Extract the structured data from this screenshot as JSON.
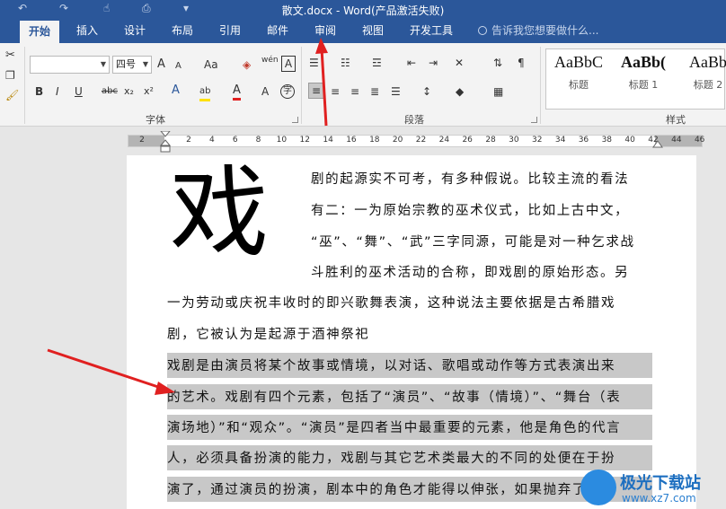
{
  "window": {
    "title": "散文.docx - Word(产品激活失败)",
    "quick_access": [
      "undo-icon",
      "redo-icon",
      "touch-mode-icon",
      "print-preview-icon",
      "customize-icon"
    ]
  },
  "tabs": [
    {
      "label": "开始",
      "active": true
    },
    {
      "label": "插入"
    },
    {
      "label": "设计"
    },
    {
      "label": "布局"
    },
    {
      "label": "引用"
    },
    {
      "label": "邮件"
    },
    {
      "label": "审阅"
    },
    {
      "label": "视图"
    },
    {
      "label": "开发工具"
    }
  ],
  "tell_me": {
    "placeholder": "告诉我您想要做什么..."
  },
  "ribbon": {
    "font": {
      "font_name": "",
      "font_size": "四号",
      "group_label": "字体",
      "grow_label": "A",
      "shrink_label": "A",
      "case_label": "Aa",
      "phonetic_label": "wén",
      "border_label": "A",
      "bold_label": "B",
      "italic_label": "I",
      "underline_label": "U",
      "strike_label": "abc",
      "sub_label": "x₂",
      "sup_label": "x²",
      "highlight_label": "ab",
      "color_label": "A",
      "enclose_label": "字"
    },
    "paragraph": {
      "group_label": "段落"
    },
    "styles": {
      "group_label": "样式",
      "items": [
        {
          "sample": "AaBbC",
          "name": "标题"
        },
        {
          "sample": "AaBb(",
          "name": "标题 1"
        },
        {
          "sample": "AaBb",
          "name": "标题 2"
        }
      ]
    }
  },
  "ruler": {
    "ticks": [
      "2",
      "2",
      "4",
      "6",
      "8",
      "10",
      "12",
      "14",
      "16",
      "18",
      "20",
      "22",
      "24",
      "26",
      "28",
      "30",
      "32",
      "34",
      "36",
      "38",
      "40",
      "42",
      "44",
      "46"
    ]
  },
  "document": {
    "drop_cap": "戏",
    "lines": [
      "剧的起源实不可考，有多种假说。比较主流的看法",
      "有二：一为原始宗教的巫术仪式，比如上古中文，",
      "“巫”、“舞”、“武”三字同源，可能是对一种乞求战",
      "斗胜利的巫术活动的合称，即戏剧的原始形态。另",
      "一为劳动或庆祝丰收时的即兴歌舞表演，这种说法主要依据是古希腊戏",
      "剧，它被认为是起源于酒神祭祀",
      "戏剧是由演员将某个故事或情境，以对话、歌唱或动作等方式表演出来",
      "的艺术。戏剧有四个元素，包括了“演员”、“故事（情境）”、“舞台（表",
      "演场地）”和“观众”。“演员”是四者当中最重要的元素，他是角色的代言",
      "人，必须具备扮演的能力，戏剧与其它艺术类最大的不同的处便在于扮",
      "演了，通过演员的扮演，剧本中的角色才能得以伸张，如果抛弃了演员"
    ]
  },
  "watermark": {
    "text": "极光下载站",
    "url": "www.xz7.com"
  },
  "colors": {
    "accent": "#2b579a",
    "arrow": "#e02020",
    "selection": "#c8c8c8"
  }
}
